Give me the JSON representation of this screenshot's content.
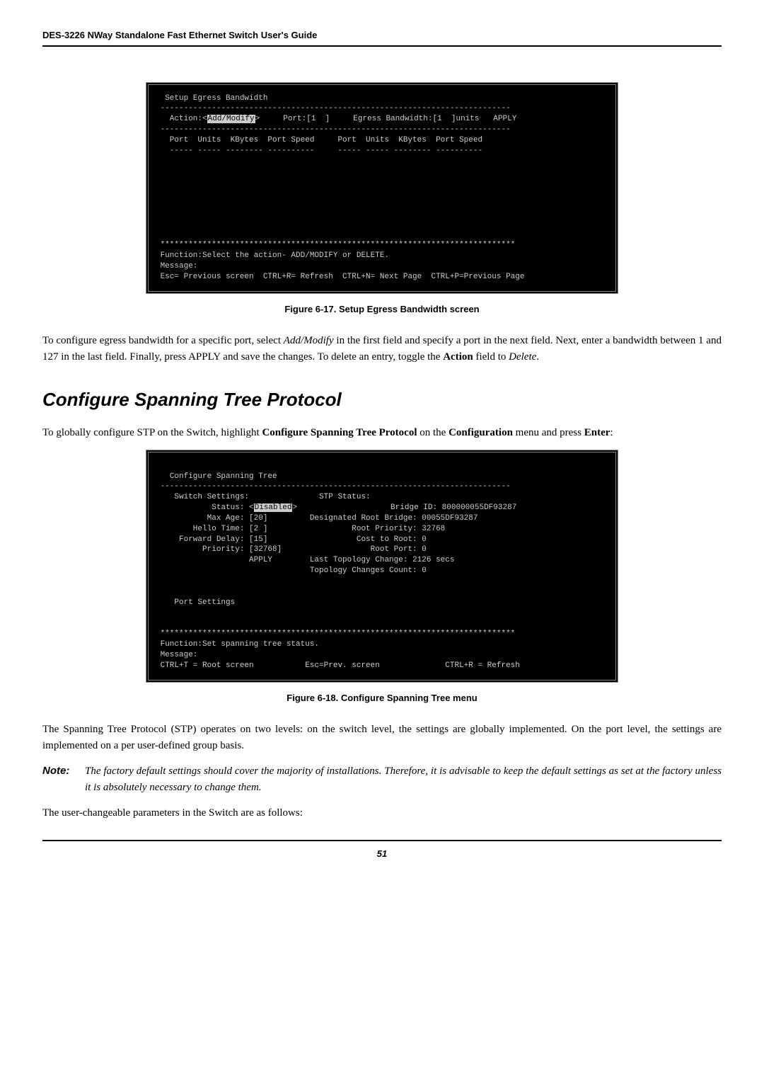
{
  "header": "DES-3226 NWay Standalone Fast Ethernet Switch User's Guide",
  "terminal1": {
    "line1": "  Setup Egress Bandwidth",
    "line2": " ---------------------------------------------------------------------------",
    "line3a": "   Action:<",
    "line3_inv": "Add/Modify",
    "line3b": ">     Port:[1  ]     Egress Bandwidth:[1  ]units   APPLY",
    "line4": " ---------------------------------------------------------------------------",
    "line5": "   Port  Units  KBytes  Port Speed     Port  Units  KBytes  Port Speed",
    "line6": "   ----- ----- -------- ----------     ----- ----- -------- ----------",
    "stars": " ****************************************************************************",
    "func": " Function:Select the action- ADD/MODIFY or DELETE.",
    "msg": " Message:",
    "nav": " Esc= Previous screen  CTRL+R= Refresh  CTRL+N= Next Page  CTRL+P=Previous Page"
  },
  "caption1": "Figure 6-17.  Setup Egress Bandwidth screen",
  "para1a": "To configure egress bandwidth for a specific port, select ",
  "para1_addmod": "Add/Modify",
  "para1b": " in the first field and specify a port in the next field. Next, enter a bandwidth between 1 and 127 in the last field. Finally, press APPLY and save the changes. To delete an entry, toggle the ",
  "para1_action": "Action",
  "para1c": " field to ",
  "para1_delete": "Delete",
  "para1d": ".",
  "section_heading": "Configure Spanning Tree Protocol",
  "para2a": "To globally configure STP on the Switch, highlight ",
  "para2_cmd": "Configure Spanning Tree Protocol",
  "para2b": " on the ",
  "para2_cfg": "Configuration",
  "para2c": " menu and press ",
  "para2_enter": "Enter",
  "para2d": ":",
  "terminal2": {
    "l1": "   Configure Spanning Tree",
    "l2": " ---------------------------------------------------------------------------",
    "l3": "    Switch Settings:               STP Status:",
    "l4a": "            Status: <",
    "l4_inv": "Disabled",
    "l4b": ">                    Bridge ID: 800000055DF93287",
    "l5": "           Max Age: [20]         Designated Root Bridge: 00055DF93287",
    "l6": "        Hello Time: [2 ]                  Root Priority: 32768",
    "l7": "     Forward Delay: [15]                   Cost to Root: 0",
    "l8": "          Priority: [32768]                   Root Port: 0",
    "l9": "                    APPLY        Last Topology Change: 2126 secs",
    "l10": "                                 Topology Changes Count: 0",
    "l11": "",
    "l12": "",
    "l13": "    Port Settings",
    "l14": "",
    "l15": "",
    "stars": " ****************************************************************************",
    "func": " Function:Set spanning tree status.",
    "msg": " Message:",
    "nav": " CTRL+T = Root screen           Esc=Prev. screen              CTRL+R = Refresh"
  },
  "caption2": "Figure 6-18.  Configure Spanning Tree menu",
  "para3": "The Spanning Tree Protocol (STP) operates on two levels: on the switch level, the settings are globally implemented. On the port level, the settings are implemented on a per user-defined group basis.",
  "note_label": "Note:",
  "note_text": "The factory default settings should cover the majority of installations. Therefore, it is advisable to keep the default settings as set at the factory unless it is absolutely necessary to change them.",
  "para4": "The user-changeable parameters in the Switch are as follows:",
  "page_number": "51"
}
